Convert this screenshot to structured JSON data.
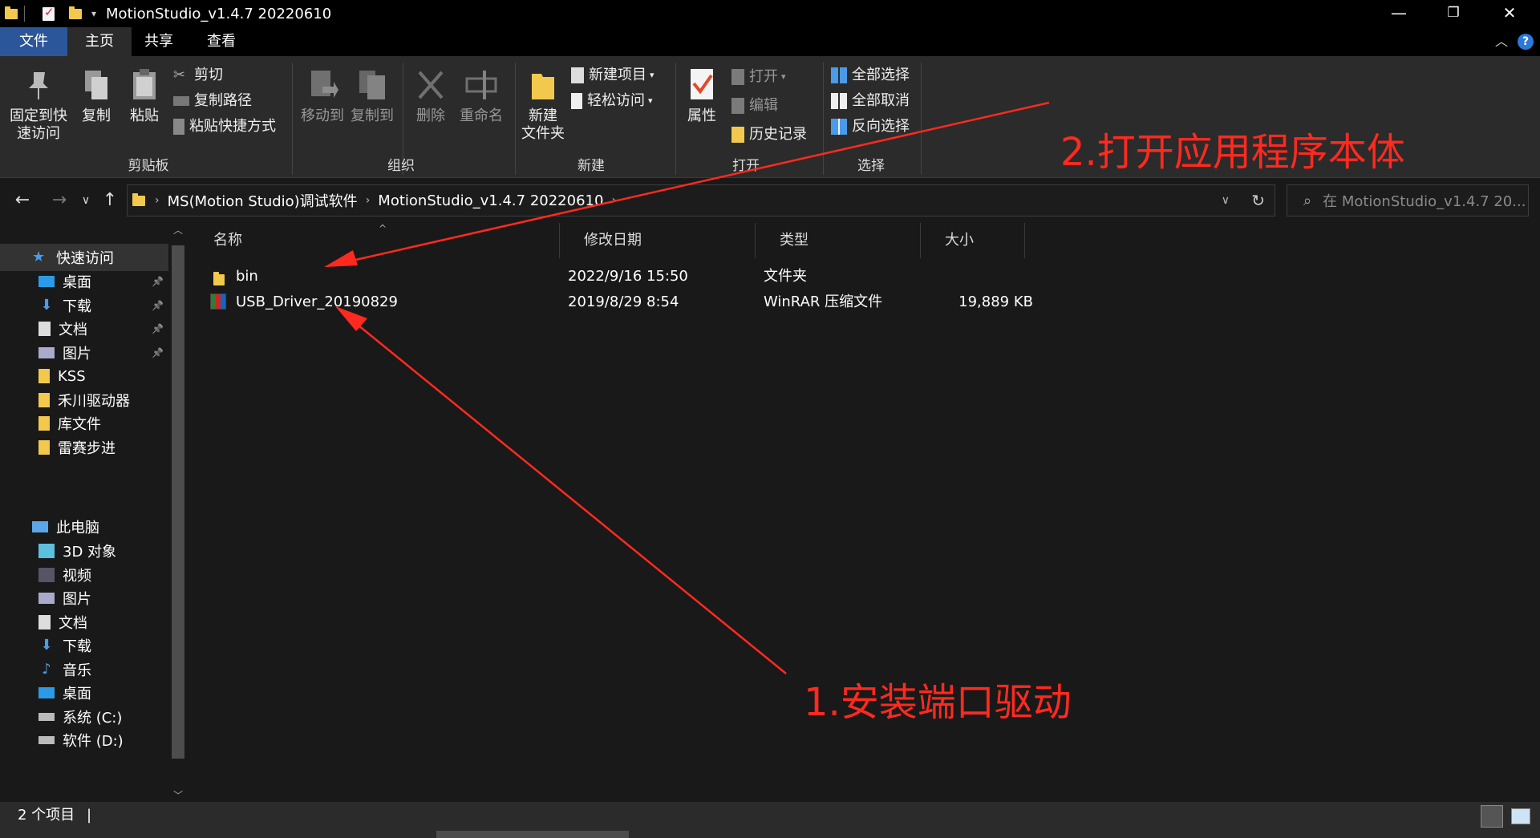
{
  "window": {
    "title": "MotionStudio_v1.4.7 20220610",
    "minimize": "—",
    "restore": "❐",
    "close": "✕"
  },
  "ribbon_tabs": [
    "文件",
    "主页",
    "共享",
    "查看"
  ],
  "ribbon": {
    "pin_quick": "固定到快速访问",
    "copy": "复制",
    "paste": "粘贴",
    "cut": "剪切",
    "copy_path": "复制路径",
    "paste_shortcut": "粘贴快捷方式",
    "group_clipboard": "剪贴板",
    "move_to": "移动到",
    "copy_to": "复制到",
    "delete": "删除",
    "rename": "重命名",
    "group_organize": "组织",
    "new_folder": "新建\n文件夹",
    "new_item": "新建项目",
    "easy_access": "轻松访问",
    "group_new": "新建",
    "properties": "属性",
    "open": "打开",
    "edit": "编辑",
    "history": "历史记录",
    "group_open": "打开",
    "select_all": "全部选择",
    "select_none": "全部取消",
    "invert_select": "反向选择",
    "group_select": "选择"
  },
  "address": {
    "crumbs": [
      "MS(Motion Studio)调试软件",
      "MotionStudio_v1.4.7 20220610"
    ],
    "search_placeholder": "在 MotionStudio_v1.4.7 20..."
  },
  "nav_pane": {
    "quick_access": "快速访问",
    "quick_items": [
      "桌面",
      "下载",
      "文档",
      "图片",
      "KSS",
      "禾川驱动器",
      "库文件",
      "雷赛步进"
    ],
    "this_pc": "此电脑",
    "pc_items": [
      "3D 对象",
      "视频",
      "图片",
      "文档",
      "下载",
      "音乐",
      "桌面",
      "系统 (C:)",
      "软件 (D:)"
    ]
  },
  "columns": [
    "名称",
    "修改日期",
    "类型",
    "大小"
  ],
  "files": [
    {
      "name": "bin",
      "modified": "2022/9/16 15:50",
      "type": "文件夹",
      "size": ""
    },
    {
      "name": "USB_Driver_20190829",
      "modified": "2019/8/29 8:54",
      "type": "WinRAR 压缩文件",
      "size": "19,889 KB"
    }
  ],
  "status": {
    "count": "2 个项目"
  },
  "annotations": {
    "step1": "1.安装端口驱动",
    "step2": "2.打开应用程序本体",
    "color": "#ff2a1f"
  }
}
